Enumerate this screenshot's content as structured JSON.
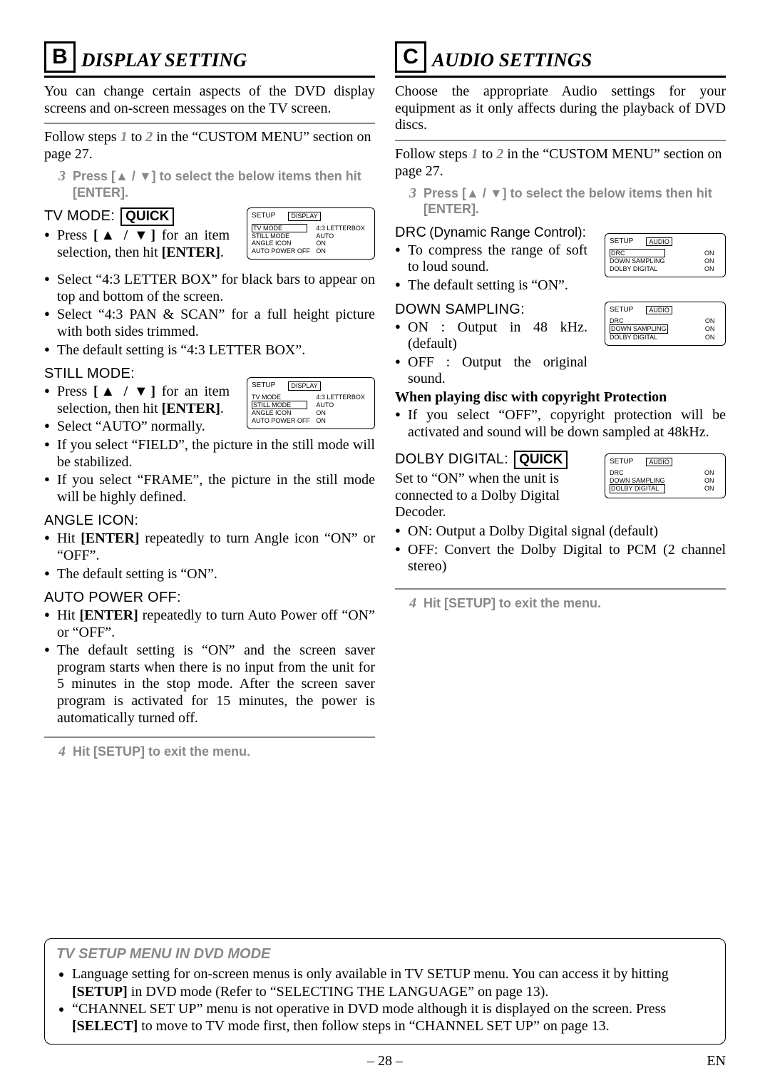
{
  "page_number": "– 28 –",
  "page_lang": "EN",
  "left": {
    "letter": "B",
    "title": "DISPLAY SETTING",
    "intro": "You can change certain aspects of the DVD display screens and on-screen messages on the TV screen.",
    "follow_pre": "Follow steps ",
    "follow_s1": "1",
    "follow_mid": " to ",
    "follow_s2": "2",
    "follow_post": " in the “CUSTOM MENU” section on page 27.",
    "step3_num": "3",
    "step3_text": "Press [▲ / ▼] to select the below items then hit [ENTER].",
    "tvmode": {
      "label": "TV MODE:",
      "quick": "QUICK",
      "bul1_a": "Press ",
      "bul1_keys": "[▲ / ▼]",
      "bul1_b": " for an item selection, then hit ",
      "bul1_enter": "[ENTER]",
      "bul1_c": ".",
      "bul2": "Select “4:3 LETTER BOX” for black bars to appear on top and bottom of the screen.",
      "bul3": "Select “4:3 PAN & SCAN” for a full height picture with both sides trimmed.",
      "bul4": "The default setting is “4:3 LETTER BOX”.",
      "fig": {
        "setup": "SETUP",
        "tab": "DISPLAY",
        "rows": [
          [
            "TV MODE",
            "4:3 LETTERBOX"
          ],
          [
            "STILL MODE",
            "AUTO"
          ],
          [
            "ANGLE ICON",
            "ON"
          ],
          [
            "AUTO POWER OFF",
            "ON"
          ]
        ],
        "hl": 0
      }
    },
    "stillmode": {
      "label": "STILL MODE:",
      "bul1_a": "Press ",
      "bul1_keys": "[▲ / ▼]",
      "bul1_b": " for an item selection, then hit ",
      "bul1_enter": "[ENTER]",
      "bul1_c": ".",
      "bul2": "Select “AUTO” normally.",
      "bul3": "If you select “FIELD”, the picture in the still mode will be stabilized.",
      "bul4": "If you select “FRAME”, the picture in the still mode will be highly defined.",
      "fig": {
        "setup": "SETUP",
        "tab": "DISPLAY",
        "rows": [
          [
            "TV MODE",
            "4:3 LETTERBOX"
          ],
          [
            "STILL MODE",
            "AUTO"
          ],
          [
            "ANGLE ICON",
            "ON"
          ],
          [
            "AUTO POWER OFF",
            "ON"
          ]
        ],
        "hl": 1
      }
    },
    "angleicon": {
      "label": "ANGLE ICON:",
      "bul1_a": "Hit ",
      "bul1_enter": "[ENTER]",
      "bul1_b": " repeatedly to turn Angle icon “ON” or “OFF”.",
      "bul2": "The default setting is “ON”."
    },
    "autopower": {
      "label": "AUTO POWER OFF:",
      "bul1_a": "Hit ",
      "bul1_enter": "[ENTER]",
      "bul1_b": " repeatedly to turn Auto Power off “ON” or “OFF”.",
      "bul2": "The default setting is “ON” and the screen saver program starts when there is no input from the unit for 5 minutes in the stop mode. After the screen saver program is activated for 15 minutes, the power is automatically turned off."
    },
    "step4_num": "4",
    "step4_text": "Hit [SETUP] to exit the menu."
  },
  "right": {
    "letter": "C",
    "title": "AUDIO SETTINGS",
    "intro": "Choose the appropriate Audio settings for your equipment as it only affects during the playback of DVD discs.",
    "follow_pre": "Follow steps ",
    "follow_s1": "1",
    "follow_mid": " to ",
    "follow_s2": "2",
    "follow_post": " in the “CUSTOM MENU” section on page 27.",
    "step3_num": "3",
    "step3_text": "Press [▲ / ▼] to select the below items then hit [ENTER].",
    "drc": {
      "label": "DRC",
      "label_paren": "(Dynamic Range Control):",
      "bul1": "To compress the range of soft to loud sound.",
      "bul2": "The default setting is “ON”.",
      "fig": {
        "setup": "SETUP",
        "tab": "AUDIO",
        "rows": [
          [
            "DRC",
            "ON"
          ],
          [
            "DOWN SAMPLING",
            "ON"
          ],
          [
            "DOLBY DIGITAL",
            "ON"
          ]
        ],
        "hl": 0
      }
    },
    "down": {
      "label": "DOWN SAMPLING:",
      "bul1": "ON : Output in 48 kHz. (default)",
      "bul2": "OFF : Output the original sound.",
      "note_head": "When playing disc with copyright Protection",
      "bul3": "If you select “OFF”, copyright protection will be activated and sound will be down sampled at 48kHz.",
      "fig": {
        "setup": "SETUP",
        "tab": "AUDIO",
        "rows": [
          [
            "DRC",
            "ON"
          ],
          [
            "DOWN SAMPLING",
            "ON"
          ],
          [
            "DOLBY DIGITAL",
            "ON"
          ]
        ],
        "hl": 1
      }
    },
    "dolby": {
      "label": "DOLBY DIGITAL:",
      "quick": "QUICK",
      "para": "Set to “ON” when the unit is connected to a Dolby Digital Decoder.",
      "bul1": "ON: Output a Dolby Digital signal (default)",
      "bul2": "OFF: Convert the Dolby Digital to PCM (2 channel stereo)",
      "fig": {
        "setup": "SETUP",
        "tab": "AUDIO",
        "rows": [
          [
            "DRC",
            "ON"
          ],
          [
            "DOWN SAMPLING",
            "ON"
          ],
          [
            "DOLBY DIGITAL",
            "ON"
          ]
        ],
        "hl": 2
      }
    },
    "step4_num": "4",
    "step4_text": "Hit [SETUP] to exit the menu."
  },
  "bottom": {
    "title": "TV SETUP MENU IN DVD MODE",
    "li1_a": "Language setting for on-screen menus is only available in TV SETUP menu. You can access it by hitting ",
    "li1_setup": "[SETUP]",
    "li1_b": " in DVD mode (Refer to “SELECTING THE LANGUAGE” on page 13).",
    "li2_a": "“CHANNEL SET UP” menu is not operative in DVD mode although it is displayed on the screen. Press ",
    "li2_select": "[SELECT]",
    "li2_b": " to move to TV mode first, then follow steps in “CHANNEL SET UP” on page 13."
  }
}
